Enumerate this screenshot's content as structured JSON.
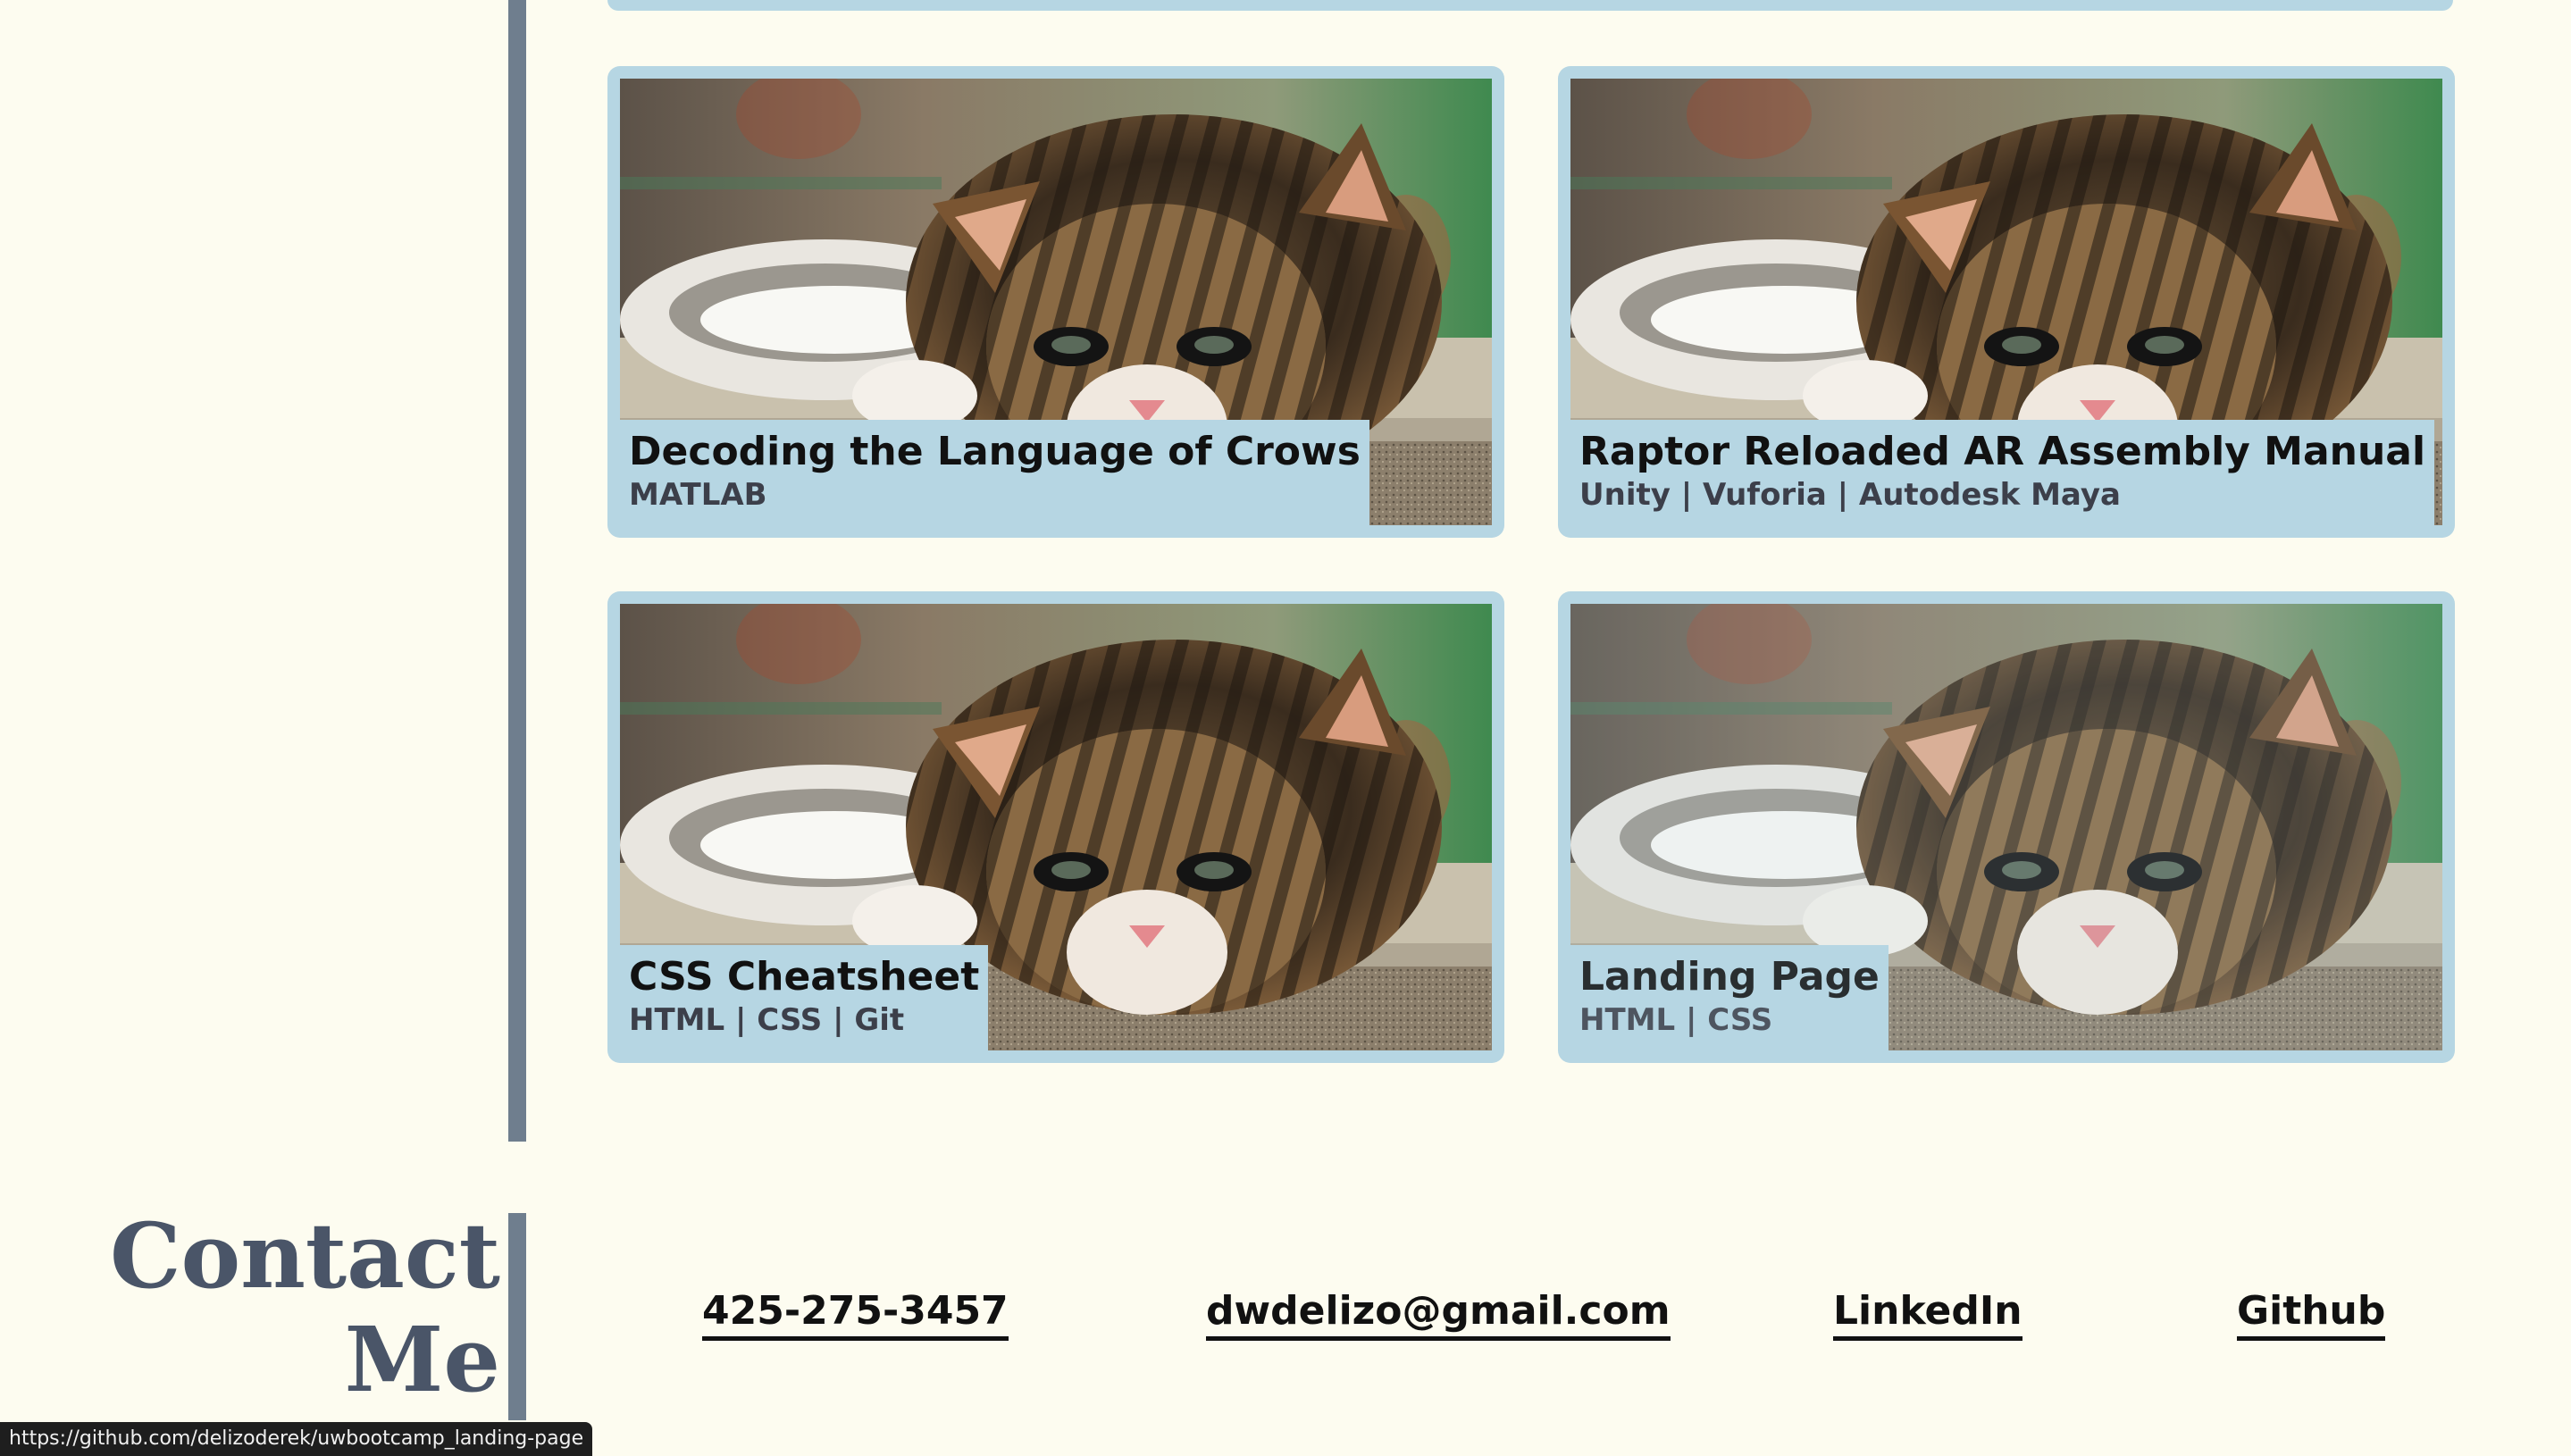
{
  "projects": [
    {
      "title": "Decoding the Language of Crows",
      "tags": "MATLAB",
      "image": "kitten-photo"
    },
    {
      "title": "Raptor Reloaded AR Assembly Manual",
      "tags": "Unity | Vuforia | Autodesk Maya",
      "image": "kitten-photo"
    },
    {
      "title": "CSS Cheatsheet",
      "tags": "HTML | CSS | Git",
      "image": "kitten-photo"
    },
    {
      "title": "Landing Page",
      "tags": "HTML | CSS",
      "image": "kitten-photo"
    }
  ],
  "contact": {
    "heading_line1": "Contact",
    "heading_line2": "Me",
    "phone": "425-275-3457",
    "email": "dwdelizo@gmail.com",
    "linkedin": "LinkedIn",
    "github": "Github"
  },
  "status_bar": {
    "url": "https://github.com/delizoderek/uwbootcamp_landing-page"
  },
  "colors": {
    "background": "#fdfcf0",
    "card": "#b6d6e3",
    "rule": "#6f7e8e",
    "heading": "#4a5568"
  }
}
